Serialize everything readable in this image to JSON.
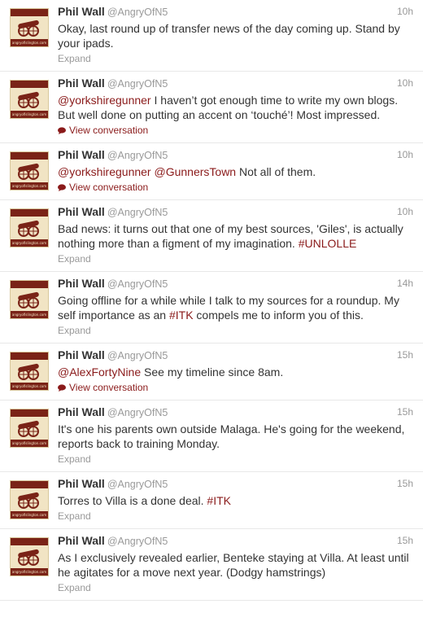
{
  "tweets": [
    {
      "name": "Phil Wall",
      "handle": "@AngryOfN5",
      "time": "10h",
      "parts": [
        {
          "t": "text",
          "v": "Okay, last round up of transfer news of the day coming up. Stand by your ipads."
        }
      ],
      "action": "Expand",
      "action_type": "expand"
    },
    {
      "name": "Phil Wall",
      "handle": "@AngryOfN5",
      "time": "10h",
      "parts": [
        {
          "t": "mention",
          "v": "@yorkshiregunner"
        },
        {
          "t": "text",
          "v": " I haven’t got enough time to write my own blogs. But well done on putting an accent on ‘touché’! Most impressed."
        }
      ],
      "action": "View conversation",
      "action_type": "conversation"
    },
    {
      "name": "Phil Wall",
      "handle": "@AngryOfN5",
      "time": "10h",
      "parts": [
        {
          "t": "mention",
          "v": "@yorkshiregunner"
        },
        {
          "t": "text",
          "v": " "
        },
        {
          "t": "mention",
          "v": "@GunnersTown"
        },
        {
          "t": "text",
          "v": " Not all of them."
        }
      ],
      "action": "View conversation",
      "action_type": "conversation"
    },
    {
      "name": "Phil Wall",
      "handle": "@AngryOfN5",
      "time": "10h",
      "parts": [
        {
          "t": "text",
          "v": "Bad news: it turns out that one of my best sources, 'Giles', is actually nothing more than a figment of my imagination. "
        },
        {
          "t": "hashtag",
          "v": "#UNLOLLE"
        }
      ],
      "action": "Expand",
      "action_type": "expand"
    },
    {
      "name": "Phil Wall",
      "handle": "@AngryOfN5",
      "time": "14h",
      "parts": [
        {
          "t": "text",
          "v": "Going offline for a while while I talk to my sources for a roundup. My self importance as an "
        },
        {
          "t": "hashtag",
          "v": "#ITK"
        },
        {
          "t": "text",
          "v": " compels me to inform you of this."
        }
      ],
      "action": "Expand",
      "action_type": "expand"
    },
    {
      "name": "Phil Wall",
      "handle": "@AngryOfN5",
      "time": "15h",
      "parts": [
        {
          "t": "mention",
          "v": "@AlexFortyNine"
        },
        {
          "t": "text",
          "v": " See my timeline since 8am."
        }
      ],
      "action": "View conversation",
      "action_type": "conversation"
    },
    {
      "name": "Phil Wall",
      "handle": "@AngryOfN5",
      "time": "15h",
      "parts": [
        {
          "t": "text",
          "v": "It's one his parents own outside Malaga. He's going for the weekend, reports back to training Monday."
        }
      ],
      "action": "Expand",
      "action_type": "expand"
    },
    {
      "name": "Phil Wall",
      "handle": "@AngryOfN5",
      "time": "15h",
      "parts": [
        {
          "t": "text",
          "v": "Torres to Villa is a done deal. "
        },
        {
          "t": "hashtag",
          "v": "#ITK"
        }
      ],
      "action": "Expand",
      "action_type": "expand"
    },
    {
      "name": "Phil Wall",
      "handle": "@AngryOfN5",
      "time": "15h",
      "parts": [
        {
          "t": "text",
          "v": "As I exclusively revealed earlier, Benteke staying at Villa. At least until he agitates for a move next year. (Dodgy hamstrings)"
        }
      ],
      "action": "Expand",
      "action_type": "expand"
    }
  ],
  "avatar": {
    "site_text": "angryofislington.com",
    "icon": "cannon-icon"
  },
  "colors": {
    "link": "#8a1a1a",
    "muted": "#999999",
    "text": "#333333",
    "avatar_bg": "#f1e4c4",
    "avatar_band": "#7a2317"
  }
}
